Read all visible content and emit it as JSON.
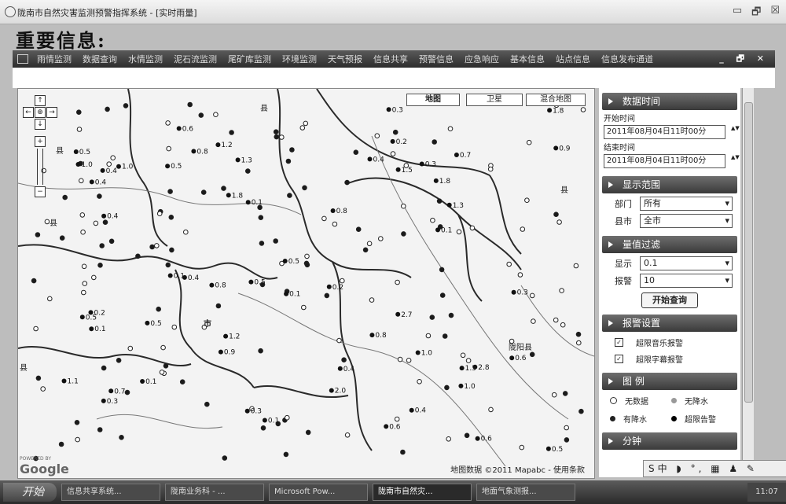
{
  "window": {
    "title": "陇南市自然灾害监测预警指挥系统 - [实时雨量]",
    "minimize": "▭",
    "restore": "🗗",
    "close": "☒"
  },
  "page_heading": "重要信息:",
  "menu": {
    "items": [
      "雨情监测",
      "数据查询",
      "水情监测",
      "泥石流监测",
      "尾矿库监测",
      "环境监测",
      "天气预报",
      "信息共享",
      "预警信息",
      "应急响应",
      "基本信息",
      "站点信息",
      "信息发布通道"
    ],
    "controls": "_ 🗗 ✕"
  },
  "map": {
    "type_buttons": [
      "地图",
      "卫星",
      "混合地图"
    ],
    "nav": {
      "up": "↑",
      "down": "↓",
      "left": "←",
      "right": "→",
      "center": "⊕",
      "zoom_in": "+",
      "zoom_out": "−"
    },
    "place_labels": [
      "县",
      "县",
      "县",
      "市",
      "县",
      "陇阳县",
      "县",
      "县"
    ],
    "copyright": "地图数据 ©2011 Mapabc - 使用条款",
    "google_powered": "POWERED BY",
    "google": "Google",
    "rain_values": [
      "1.8",
      "0.9",
      "2.0",
      "0.8",
      "1.3",
      "2.8",
      "2.7",
      "1.1",
      "0.9",
      "0.5",
      "1.3",
      "1.8",
      "0.5",
      "1.0",
      "0.4",
      "1.2",
      "1.5",
      "1.0",
      "0.2",
      "0.8",
      "0.5",
      "0.6",
      "0.5",
      "0.4",
      "0.3",
      "0.1",
      "0.5",
      "0.8",
      "0.1",
      "0.4",
      "1.2",
      "0.4",
      "0.6",
      "0.3",
      "1.0",
      "1.8",
      "0.1",
      "0.5",
      "0.6",
      "1.3",
      "0.6",
      "0.4",
      "0.7",
      "0.3",
      "1.0",
      "0.1",
      "0.2",
      "0.3",
      "0.7",
      "0.3",
      "0.5",
      "0.4",
      "0.1",
      "0.2",
      "0.1",
      "0.8",
      "0.4",
      "0.1"
    ]
  },
  "panel": {
    "data_time": {
      "header": "数据时间",
      "start_label": "开始时间",
      "start_value": "2011年08月04日11时00分",
      "end_label": "结束时间",
      "end_value": "2011年08月04日11时00分"
    },
    "display_range": {
      "header": "显示范围",
      "dept_label": "部门",
      "dept_value": "所有",
      "county_label": "县市",
      "county_value": "全市"
    },
    "threshold": {
      "header": "量值过滤",
      "show_label": "显示",
      "show_value": "0.1",
      "alarm_label": "报警",
      "alarm_value": "10",
      "query_button": "开始查询"
    },
    "alarm_settings": {
      "header": "报警设置",
      "sound": "超限音乐报警",
      "subtitle": "超限字幕报警"
    },
    "legend": {
      "header": "图 例",
      "no_data": "无数据",
      "no_rain": "无降水",
      "rain": "有降水",
      "over_alarm": "超限告警"
    },
    "partial_header": "分钟"
  },
  "ime": "S中 ◗ °, ▦ ♟ ✎",
  "taskbar": {
    "start": "开始",
    "tasks": [
      "信息共享系统...",
      "陇南业务科 - ...",
      "Microsoft Pow...",
      "陇南市自然灾...",
      "地面气象测报..."
    ],
    "clock": "11:07"
  },
  "colors": {
    "menubar": "#3f3f3f",
    "panel_header": "#4a4a4a",
    "river": "#555555"
  }
}
